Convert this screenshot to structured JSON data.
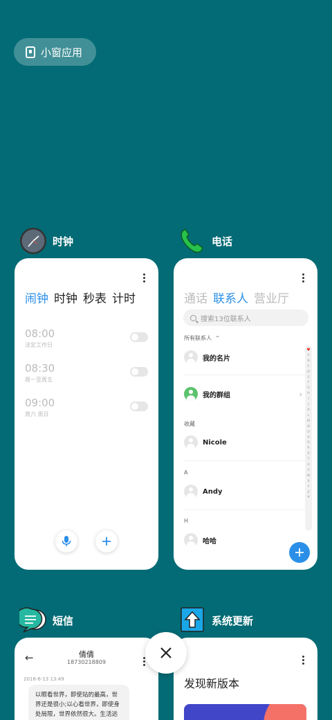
{
  "floating_window": {
    "label": "小窗应用",
    "icon": "floating-window-icon"
  },
  "apps": {
    "clock": {
      "name": "时钟",
      "icon": "clock-icon",
      "tabs": [
        "闹钟",
        "时钟",
        "秒表",
        "计时"
      ],
      "alarms": [
        {
          "time": "08:00",
          "repeat": "法定工作日",
          "enabled": false
        },
        {
          "time": "08:30",
          "repeat": "周一至周五",
          "enabled": false
        },
        {
          "time": "09:00",
          "repeat": "周六 周日",
          "enabled": false
        }
      ]
    },
    "phone": {
      "name": "电话",
      "icon": "phone-icon",
      "tabs": [
        "通话",
        "联系人",
        "营业厅"
      ],
      "search_placeholder": "搜索13位联系人",
      "all_contacts_label": "所有联系人",
      "my_card": "我的名片",
      "my_groups": "我的群组",
      "favorites_label": "收藏",
      "sections": [
        {
          "header": "",
          "contact": "Nicole"
        },
        {
          "header": "A",
          "contact": "Andy"
        },
        {
          "header": "H",
          "contact": "哈哈"
        }
      ],
      "index_letters": [
        "A",
        "B",
        "C",
        "D",
        "E",
        "F",
        "G",
        "H",
        "I",
        "J",
        "K",
        "L",
        "M",
        "N",
        "O",
        "P",
        "Q",
        "R",
        "S",
        "T",
        "U",
        "V",
        "W",
        "X",
        "Y",
        "Z",
        "#"
      ]
    },
    "sms": {
      "name": "短信",
      "icon": "message-icon",
      "contact_name": "倩倩",
      "contact_number": "18730218809",
      "date": "2016-6-13 13:49",
      "message": "以眼看世界，即使站的最高，世界还是很小;以心看世界，即使身处局限，世界依然很大。生活远不完美，需要用人去体会，需要用心去感受。"
    },
    "update": {
      "name": "系统更新",
      "icon": "system-update-icon",
      "title": "发现新版本"
    }
  },
  "colors": {
    "background": "#036b75",
    "accent": "#2b8fe8"
  }
}
